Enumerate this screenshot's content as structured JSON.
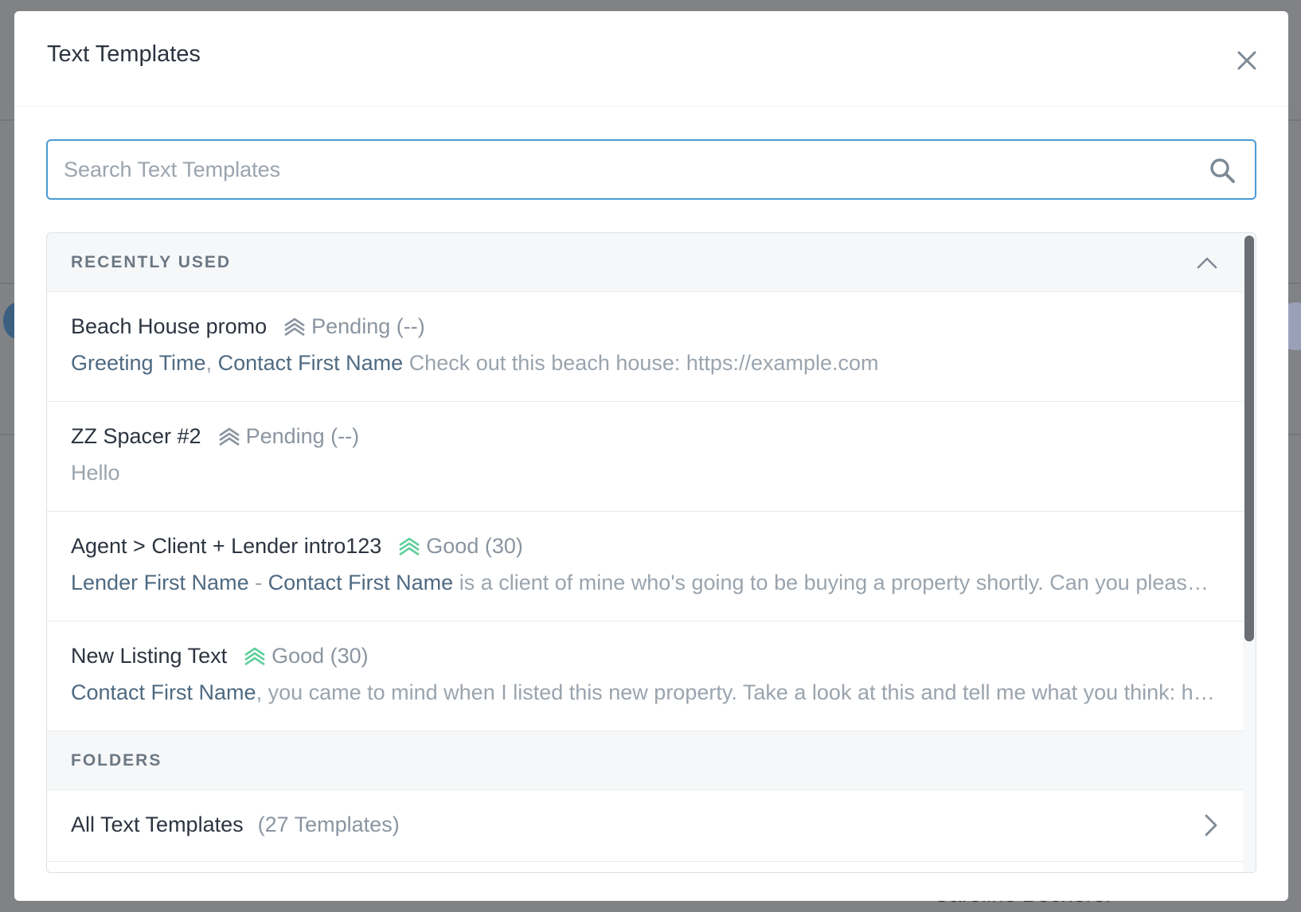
{
  "modal": {
    "title": "Text Templates"
  },
  "search": {
    "placeholder": "Search Text Templates"
  },
  "recently_used": {
    "title": "RECENTLY USED",
    "items": [
      {
        "name": "Beach House promo",
        "status": "Pending (--)",
        "rank_color": "#8a95a1",
        "merge_1": "Greeting Time",
        "sep_1": ",",
        "merge_2": "Contact First Name",
        "text": "Check out this beach house: https://example.com"
      },
      {
        "name": "ZZ Spacer #2",
        "status": "Pending (--)",
        "rank_color": "#8a95a1",
        "text": "Hello"
      },
      {
        "name": "Agent > Client + Lender intro123",
        "status": "Good (30)",
        "rank_color": "#5fcf9a",
        "merge_1": "Lender First Name",
        "sep_1": "-",
        "merge_2": "Contact First Name",
        "text": "is a client of mine who's going to be buying a property shortly. Can you please reach out to them?"
      },
      {
        "name": "New Listing Text",
        "status": "Good (30)",
        "rank_color": "#5fcf9a",
        "merge_1": "Contact First Name",
        "text": ", you came to mind when I listed this new property. Take a look at this and tell me what you think: https://example.com"
      }
    ]
  },
  "folders": {
    "title": "FOLDERS",
    "items": [
      {
        "name": "All Text Templates",
        "count": "(27 Templates)"
      }
    ]
  },
  "background": {
    "partial_name": "Caroline Becherer"
  }
}
